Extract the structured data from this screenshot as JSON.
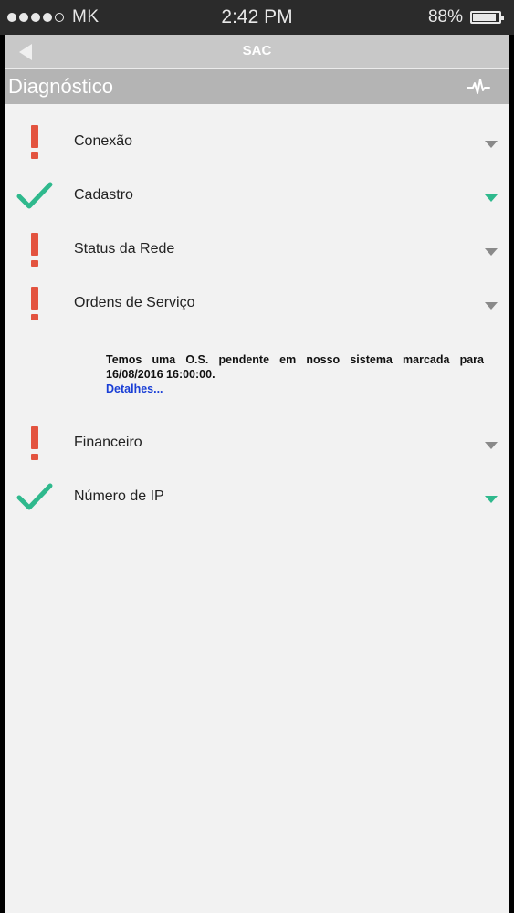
{
  "status_bar": {
    "carrier": "MK",
    "time": "2:42 PM",
    "battery_percent": "88%",
    "battery_level": 0.88,
    "signal_bars": 4
  },
  "nav": {
    "title": "SAC",
    "back_icon": "back-arrow-icon"
  },
  "section": {
    "title": "Diagnóstico",
    "icon": "pulse-icon"
  },
  "items": [
    {
      "label": "Conexão",
      "status": "alert"
    },
    {
      "label": "Cadastro",
      "status": "ok"
    },
    {
      "label": "Status da Rede",
      "status": "alert"
    },
    {
      "label": "Ordens de Serviço",
      "status": "alert"
    },
    {
      "label": "Financeiro",
      "status": "alert"
    },
    {
      "label": "Número de IP",
      "status": "ok"
    }
  ],
  "service_order_detail": {
    "message": "Temos uma O.S. pendente em nosso sistema marcada para 16/08/2016 16:00:00.",
    "link": "Detalhes..."
  },
  "colors": {
    "alert": "#e3533f",
    "ok": "#2fb98d",
    "caret_grey": "#8a8a8a",
    "caret_green": "#2fb98d"
  }
}
